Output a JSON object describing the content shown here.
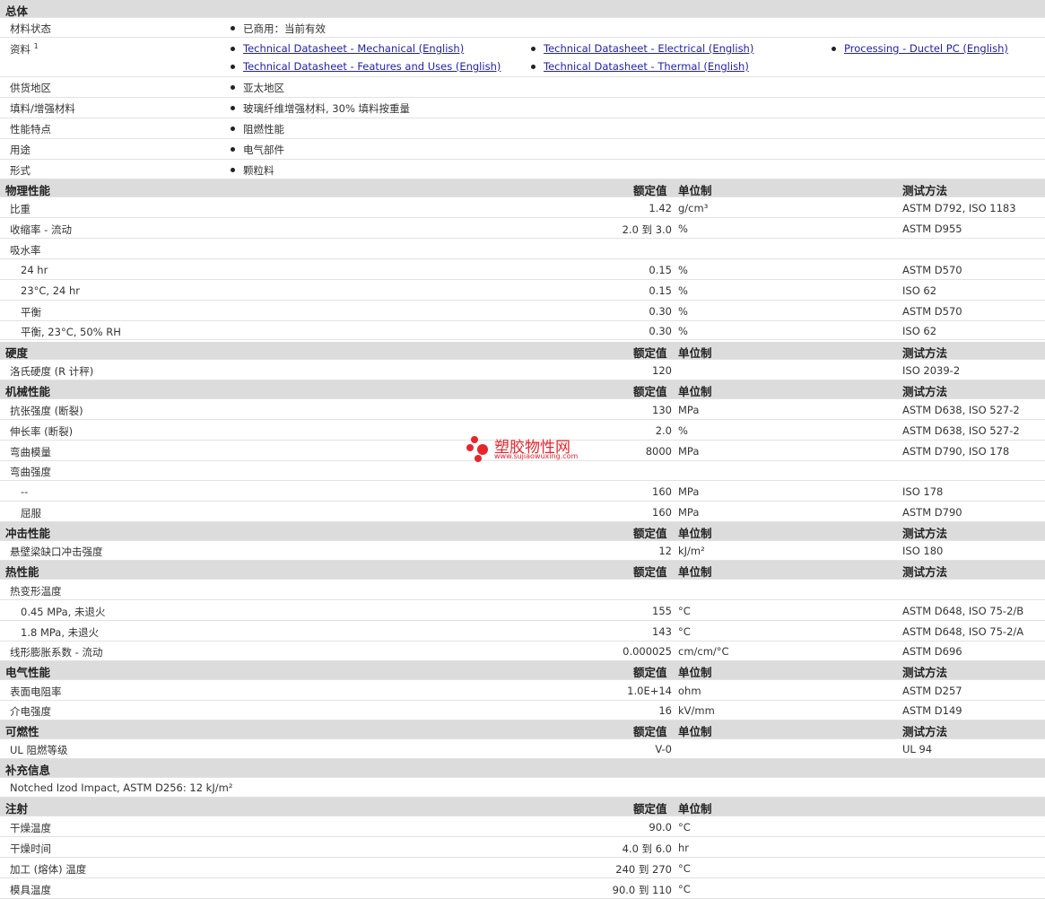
{
  "general": {
    "header": "总体",
    "status_label": "材料状态",
    "status_value": "已商用：当前有效",
    "docs_label": "资料",
    "docs_sup": "1",
    "docs": [
      "Technical Datasheet - Mechanical (English)",
      "Technical Datasheet - Electrical (English)",
      "Processing - Ductel PC (English)",
      "Technical Datasheet - Features and Uses (English)",
      "Technical Datasheet - Thermal (English)"
    ],
    "region_label": "供货地区",
    "region_value": "亚太地区",
    "filler_label": "填料/增强材料",
    "filler_value": "玻璃纤维增强材料, 30% 填料按重量",
    "feature_label": "性能特点",
    "feature_value": "阻燃性能",
    "use_label": "用途",
    "use_value": "电气部件",
    "form_label": "形式",
    "form_value": "颗粒料"
  },
  "headers": {
    "value": "额定值",
    "unit": "单位制",
    "method": "测试方法"
  },
  "physical": {
    "title": "物理性能",
    "rows": [
      {
        "label": "比重",
        "value": "1.42",
        "unit": "g/cm³",
        "method": "ASTM D792, ISO 1183"
      },
      {
        "label": "收缩率 - 流动",
        "value": "2.0 到  3.0",
        "unit": "%",
        "method": "ASTM D955"
      },
      {
        "label": "吸水率",
        "value": "",
        "unit": "",
        "method": ""
      },
      {
        "label": "24 hr",
        "value": "0.15",
        "unit": "%",
        "method": "ASTM D570"
      },
      {
        "label": "23°C, 24 hr",
        "value": "0.15",
        "unit": "%",
        "method": "ISO 62"
      },
      {
        "label": "平衡",
        "value": "0.30",
        "unit": "%",
        "method": "ASTM D570"
      },
      {
        "label": "平衡, 23°C, 50% RH",
        "value": "0.30",
        "unit": "%",
        "method": "ISO 62"
      }
    ]
  },
  "hardness": {
    "title": "硬度",
    "rows": [
      {
        "label": "洛氏硬度 (R 计秤)",
        "value": "120",
        "unit": "",
        "method": "ISO 2039-2"
      }
    ]
  },
  "mechanical": {
    "title": "机械性能",
    "rows": [
      {
        "label": "抗张强度 (断裂)",
        "value": "130",
        "unit": "MPa",
        "method": "ASTM D638, ISO 527-2"
      },
      {
        "label": "伸长率 (断裂)",
        "value": "2.0",
        "unit": "%",
        "method": "ASTM D638, ISO 527-2"
      },
      {
        "label": "弯曲模量",
        "value": "8000",
        "unit": "MPa",
        "method": "ASTM D790, ISO 178"
      },
      {
        "label": "弯曲强度",
        "value": "",
        "unit": "",
        "method": ""
      },
      {
        "label": "--",
        "value": "160",
        "unit": "MPa",
        "method": "ISO 178"
      },
      {
        "label": "屈服",
        "value": "160",
        "unit": "MPa",
        "method": "ASTM D790"
      }
    ]
  },
  "impact": {
    "title": "冲击性能",
    "rows": [
      {
        "label": "悬壁梁缺口冲击强度",
        "value": "12",
        "unit": "kJ/m²",
        "method": "ISO 180"
      }
    ]
  },
  "thermal": {
    "title": "热性能",
    "rows": [
      {
        "label": "热变形温度",
        "value": "",
        "unit": "",
        "method": ""
      },
      {
        "label": "0.45 MPa, 未退火",
        "value": "155",
        "unit": "°C",
        "method": "ASTM D648, ISO 75-2/B"
      },
      {
        "label": "1.8 MPa, 未退火",
        "value": "143",
        "unit": "°C",
        "method": "ASTM D648, ISO 75-2/A"
      },
      {
        "label": "线形膨胀系数 - 流动",
        "value": "0.000025",
        "unit": "cm/cm/°C",
        "method": "ASTM D696"
      }
    ]
  },
  "electrical": {
    "title": "电气性能",
    "rows": [
      {
        "label": "表面电阻率",
        "value": "1.0E+14",
        "unit": "ohm",
        "method": "ASTM D257"
      },
      {
        "label": "介电强度",
        "value": "16",
        "unit": "kV/mm",
        "method": "ASTM D149"
      }
    ]
  },
  "flammability": {
    "title": "可燃性",
    "rows": [
      {
        "label": "UL 阻燃等级",
        "value": "V-0",
        "unit": "",
        "method": "UL 94"
      }
    ]
  },
  "supplement": {
    "title": "补充信息",
    "text": "Notched Izod Impact, ASTM D256: 12 kJ/m²"
  },
  "injection": {
    "title": "注射",
    "rows": [
      {
        "label": "干燥温度",
        "value": "90.0",
        "unit": "°C",
        "method": ""
      },
      {
        "label": "干燥时间",
        "value": "4.0 到  6.0",
        "unit": "hr",
        "method": ""
      },
      {
        "label": "加工 (熔体) 温度",
        "value": "240 到  270",
        "unit": "°C",
        "method": ""
      },
      {
        "label": "模具温度",
        "value": "90.0 到  110",
        "unit": "°C",
        "method": ""
      }
    ]
  },
  "watermark": {
    "title": "塑胶物性网",
    "url": "www.sujiaowuxing.com",
    "color": "#e8252d"
  },
  "colors": {
    "section_bg": "#dcdcdc",
    "link": "#2222aa"
  }
}
